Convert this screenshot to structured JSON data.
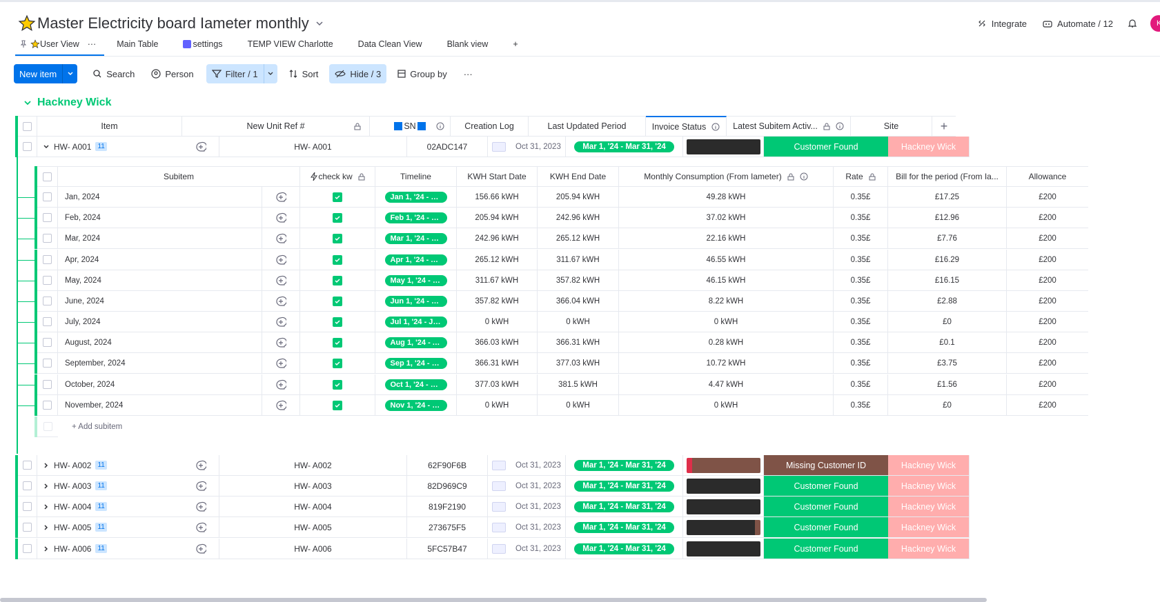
{
  "header": {
    "title": "Master Electricity board Iameter monthly",
    "integrate": "Integrate",
    "automate": "Automate / 12",
    "avatar_initial": "K"
  },
  "views": {
    "items": [
      {
        "label": "User View",
        "active": true
      },
      {
        "label": "Main Table"
      },
      {
        "label": "settings"
      },
      {
        "label": "TEMP VIEW Charlotte"
      },
      {
        "label": "Data Clean View"
      },
      {
        "label": "Blank view"
      }
    ],
    "more": "···",
    "add": "+"
  },
  "toolbar": {
    "new_item": "New item",
    "search": "Search",
    "person": "Person",
    "filter": "Filter / 1",
    "sort": "Sort",
    "hide": "Hide / 3",
    "group_by": "Group by",
    "more": "···"
  },
  "group": {
    "name": "Hackney Wick",
    "columns": {
      "item": "Item",
      "unit_ref": "New Unit Ref #",
      "sn": "SN",
      "creation_log": "Creation Log",
      "last_updated": "Last Updated Period",
      "invoice_status": "Invoice Status",
      "latest_subitem": "Latest Subitem Activ...",
      "site": "Site",
      "add": "+"
    },
    "rows": [
      {
        "item": "HW- A001",
        "count": "11",
        "unit": "HW- A001",
        "sn": "02ADC147",
        "date": "Oct 31, 2023",
        "period": "Mar 1, '24 - Mar 31, '24",
        "status": "Customer Found",
        "site": "Hackney Wick"
      },
      {
        "item": "HW- A002",
        "count": "11",
        "unit": "HW- A002",
        "sn": "62F90F6B",
        "date": "Oct 31, 2023",
        "period": "Mar 1, '24 - Mar 31, '24",
        "status": "Missing Customer ID",
        "site": "Hackney Wick"
      },
      {
        "item": "HW- A003",
        "count": "11",
        "unit": "HW- A003",
        "sn": "82D969C9",
        "date": "Oct 31, 2023",
        "period": "Mar 1, '24 - Mar 31, '24",
        "status": "Customer Found",
        "site": "Hackney Wick"
      },
      {
        "item": "HW- A004",
        "count": "11",
        "unit": "HW- A004",
        "sn": "819F2190",
        "date": "Oct 31, 2023",
        "period": "Mar 1, '24 - Mar 31, '24",
        "status": "Customer Found",
        "site": "Hackney Wick"
      },
      {
        "item": "HW- A005",
        "count": "11",
        "unit": "HW- A005",
        "sn": "273675F5",
        "date": "Oct 31, 2023",
        "period": "Mar 1, '24 - Mar 31, '24",
        "status": "Customer Found",
        "site": "Hackney Wick"
      },
      {
        "item": "HW- A006",
        "count": "11",
        "unit": "HW- A006",
        "sn": "5FC57B47",
        "date": "Oct 31, 2023",
        "period": "Mar 1, '24 - Mar 31, '24",
        "status": "Customer Found",
        "site": "Hackney Wick"
      }
    ]
  },
  "subitems": {
    "columns": {
      "subitem": "Subitem",
      "check_kw": "check kw",
      "timeline": "Timeline",
      "kwh_start": "KWH Start Date",
      "kwh_end": "KWH End Date",
      "monthly": "Monthly Consumption (From Iameter)",
      "rate": "Rate",
      "bill": "Bill for the period (From Ia...",
      "allowance": "Allowance"
    },
    "rows": [
      {
        "name": "Jan, 2024",
        "timeline": "Jan 1, '24 - Ja...",
        "start": "156.66 kWH",
        "end": "205.94 kWH",
        "monthly": "49.28 kWH",
        "rate": "0.35£",
        "bill": "£17.25",
        "allowance": "£200"
      },
      {
        "name": "Feb, 2024",
        "timeline": "Feb 1, '24 - Fe...",
        "start": "205.94 kWH",
        "end": "242.96 kWH",
        "monthly": "37.02 kWH",
        "rate": "0.35£",
        "bill": "£12.96",
        "allowance": "£200"
      },
      {
        "name": "Mar, 2024",
        "timeline": "Mar 1, '24 - M...",
        "start": "242.96 kWH",
        "end": "265.12 kWH",
        "monthly": "22.16 kWH",
        "rate": "0.35£",
        "bill": "£7.76",
        "allowance": "£200"
      },
      {
        "name": "Apr, 2024",
        "timeline": "Apr 1, '24 - Ap...",
        "start": "265.12 kWH",
        "end": "311.67 kWH",
        "monthly": "46.55 kWH",
        "rate": "0.35£",
        "bill": "£16.29",
        "allowance": "£200"
      },
      {
        "name": "May, 2024",
        "timeline": "May 1, '24 - M...",
        "start": "311.67 kWH",
        "end": "357.82 kWH",
        "monthly": "46.15 kWH",
        "rate": "0.35£",
        "bill": "£16.15",
        "allowance": "£200"
      },
      {
        "name": "June, 2024",
        "timeline": "Jun 1, '24 - Ju...",
        "start": "357.82 kWH",
        "end": "366.04 kWH",
        "monthly": "8.22 kWH",
        "rate": "0.35£",
        "bill": "£2.88",
        "allowance": "£200"
      },
      {
        "name": "July, 2024",
        "timeline": "Jul 1, '24 - Jul ...",
        "start": "0 kWH",
        "end": "0 kWH",
        "monthly": "0 kWH",
        "rate": "0.35£",
        "bill": "£0",
        "allowance": "£200"
      },
      {
        "name": "August, 2024",
        "timeline": "Aug 1, '24 - A...",
        "start": "366.03 kWH",
        "end": "366.31 kWH",
        "monthly": "0.28 kWH",
        "rate": "0.35£",
        "bill": "£0.1",
        "allowance": "£200"
      },
      {
        "name": "September, 2024",
        "timeline": "Sep 1, '24 - Se...",
        "start": "366.31 kWH",
        "end": "377.03 kWH",
        "monthly": "10.72 kWH",
        "rate": "0.35£",
        "bill": "£3.75",
        "allowance": "£200"
      },
      {
        "name": "October, 2024",
        "timeline": "Oct 1, '24 - O...",
        "start": "377.03 kWH",
        "end": "381.5 kWH",
        "monthly": "4.47 kWH",
        "rate": "0.35£",
        "bill": "£1.56",
        "allowance": "£200"
      },
      {
        "name": "November, 2024",
        "timeline": "Nov 1, '24 - N...",
        "start": "0 kWH",
        "end": "0 kWH",
        "monthly": "0 kWH",
        "rate": "0.35£",
        "bill": "£0",
        "allowance": "£200"
      }
    ],
    "add_label": "+ Add subitem"
  },
  "colors": {
    "accent": "#0073ea",
    "green": "#00c875",
    "brown": "#7f5347",
    "pink": "#ffadad"
  }
}
